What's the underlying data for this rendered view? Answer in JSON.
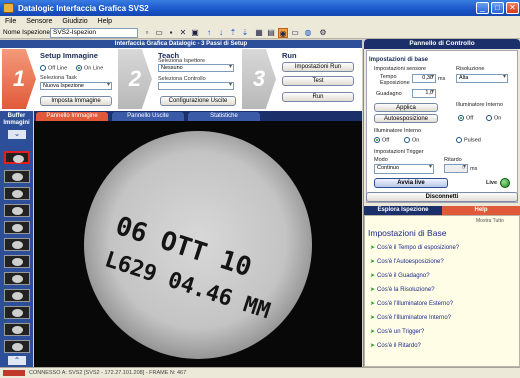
{
  "window": {
    "title": "Datalogic Interfaccia Grafica SVS2"
  },
  "menu": [
    "File",
    "Sensore",
    "Giudizio",
    "Help"
  ],
  "toolbar": {
    "inspection_label": "Nome Ispezione:",
    "inspection_value": "SVS2-Ispezion"
  },
  "setup": {
    "header": "Interfaccia Grafica Datalogic - 3 Passi di Setup",
    "step1": {
      "number": "1",
      "title": "Setup Immagine",
      "offline": "Off Line",
      "online": "On Line",
      "task_label": "Seleziona Task",
      "task_value": "Nuova Ispezione",
      "button": "Imposta Immagine"
    },
    "step2": {
      "number": "2",
      "title": "Teach",
      "teach_label": "Seleziona Ispettore",
      "teach_value": "Nessuno",
      "control_label": "Seleziona Controllo",
      "control_value": "",
      "button": "Configurazione Uscite"
    },
    "step3": {
      "number": "3",
      "title": "Run",
      "btn_setup": "Impostazioni Run",
      "btn_test": "Test",
      "btn_run": "Run"
    }
  },
  "buffer": {
    "title_line1": "Buffer",
    "title_line2": "Immagini"
  },
  "tabs": [
    "Pannello Immagine",
    "Pannello Uscite",
    "Statistiche"
  ],
  "image": {
    "line1": "06 OTT 10",
    "line2": "L629 04.46 MM"
  },
  "control": {
    "header": "Pannello di Controllo",
    "section": "Impostazioni di base",
    "sensor_label": "Impostazioni sensore",
    "exposure_label": "Tempo Esposizione",
    "exposure_value": "0,30",
    "exposure_unit": "ms",
    "gain_label": "Guadagno",
    "gain_value": "1,0",
    "resolution_label": "Risoluzione",
    "resolution_value": "Alta",
    "apply": "Applica",
    "auto": "Autoesposizione",
    "internal_light_label": "Illuminatore Interno",
    "internal_off": "Off",
    "internal_on": "On",
    "illum_label": "Illuminatore Interno",
    "illum_off": "Off",
    "illum_on": "On",
    "illum_strobe": "Pulsed",
    "trigger_label": "Impostazioni Trigger",
    "mode_label": "Modo",
    "mode_value": "Continuo",
    "delay_label": "Ritardo",
    "delay_value": "0",
    "delay_unit": "ms",
    "live_btn": "Avvia live",
    "live_label": "Live",
    "disconnect": "Disconnetti"
  },
  "help": {
    "tab_explore": "Esplora Ispezione",
    "tab_help": "Help",
    "show_all": "Mostra Tutto",
    "title": "Impostazioni di Base",
    "items": [
      "Cos'è il Tempo di esposizione?",
      "Cos'è l'Autoesposizione?",
      "Cos'è il Guadagno?",
      "Cos'è la Risoluzione?",
      "Cos'è l'Illuminatore Esterno?",
      "Cos'è l'Illuminatore Interno?",
      "Cos'è un Trigger?",
      "Cos'è il Ritardo?"
    ]
  },
  "status": {
    "text": "CONNESSO A: SVS2 [SVS2 - 172.27.101.208] - FRAME N: 467"
  }
}
